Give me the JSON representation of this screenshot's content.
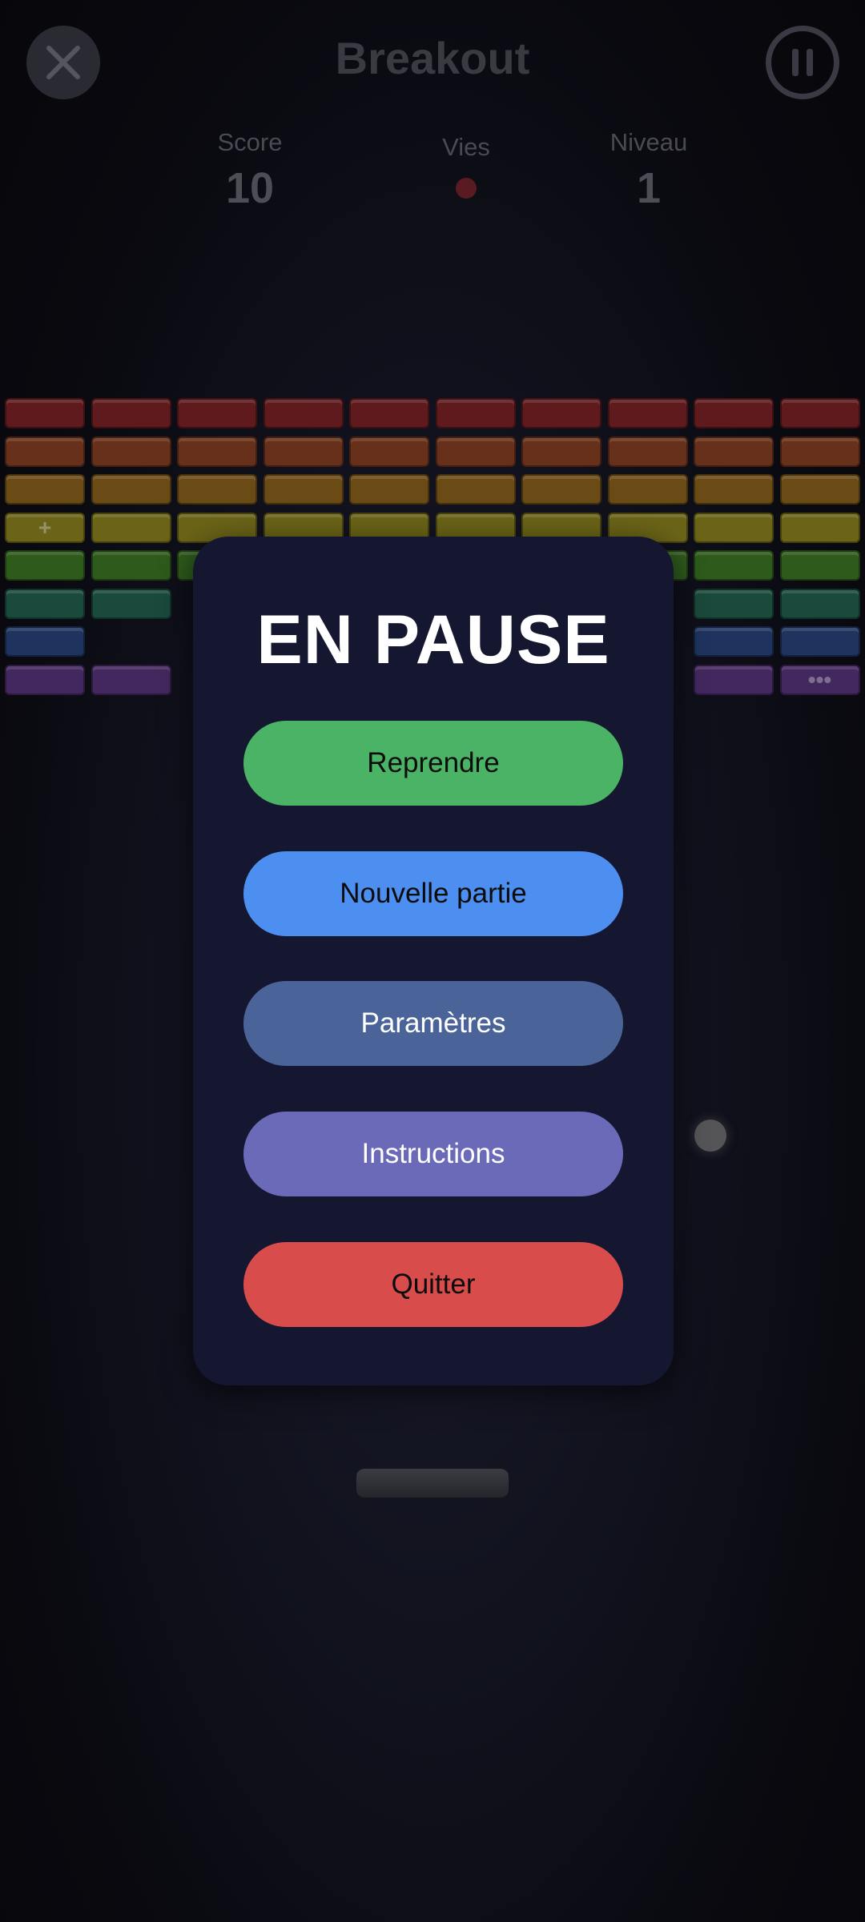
{
  "header": {
    "title": "Breakout",
    "close_icon": "close-icon",
    "pause_icon": "pause-icon"
  },
  "stats": {
    "score_label": "Score",
    "score_value": "10",
    "lives_label": "Vies",
    "lives_remaining": 1,
    "level_label": "Niveau",
    "level_value": "1"
  },
  "bricks": {
    "columns": 10,
    "row_colors": [
      "#5e1a1c",
      "#66301a",
      "#6a4a15",
      "#6b6418",
      "#2e5a1c",
      "#1a4a3c",
      "#1e345e",
      "#42285e"
    ],
    "missing_cells": [
      [
        5,
        2
      ],
      [
        5,
        3
      ],
      [
        5,
        4
      ],
      [
        5,
        5
      ],
      [
        5,
        6
      ],
      [
        5,
        7
      ],
      [
        6,
        1
      ],
      [
        6,
        2
      ],
      [
        6,
        3
      ],
      [
        6,
        4
      ],
      [
        6,
        5
      ],
      [
        6,
        6
      ],
      [
        6,
        7
      ],
      [
        7,
        2
      ],
      [
        7,
        3
      ],
      [
        7,
        4
      ],
      [
        7,
        5
      ],
      [
        7,
        6
      ],
      [
        7,
        7
      ]
    ],
    "markers": [
      {
        "row": 3,
        "col": 0,
        "symbol": "+"
      },
      {
        "row": 7,
        "col": 9,
        "symbol": "•••"
      }
    ]
  },
  "modal": {
    "title": "EN PAUSE",
    "resume_label": "Reprendre",
    "new_game_label": "Nouvelle partie",
    "settings_label": "Paramètres",
    "instructions_label": "Instructions",
    "quit_label": "Quitter"
  }
}
